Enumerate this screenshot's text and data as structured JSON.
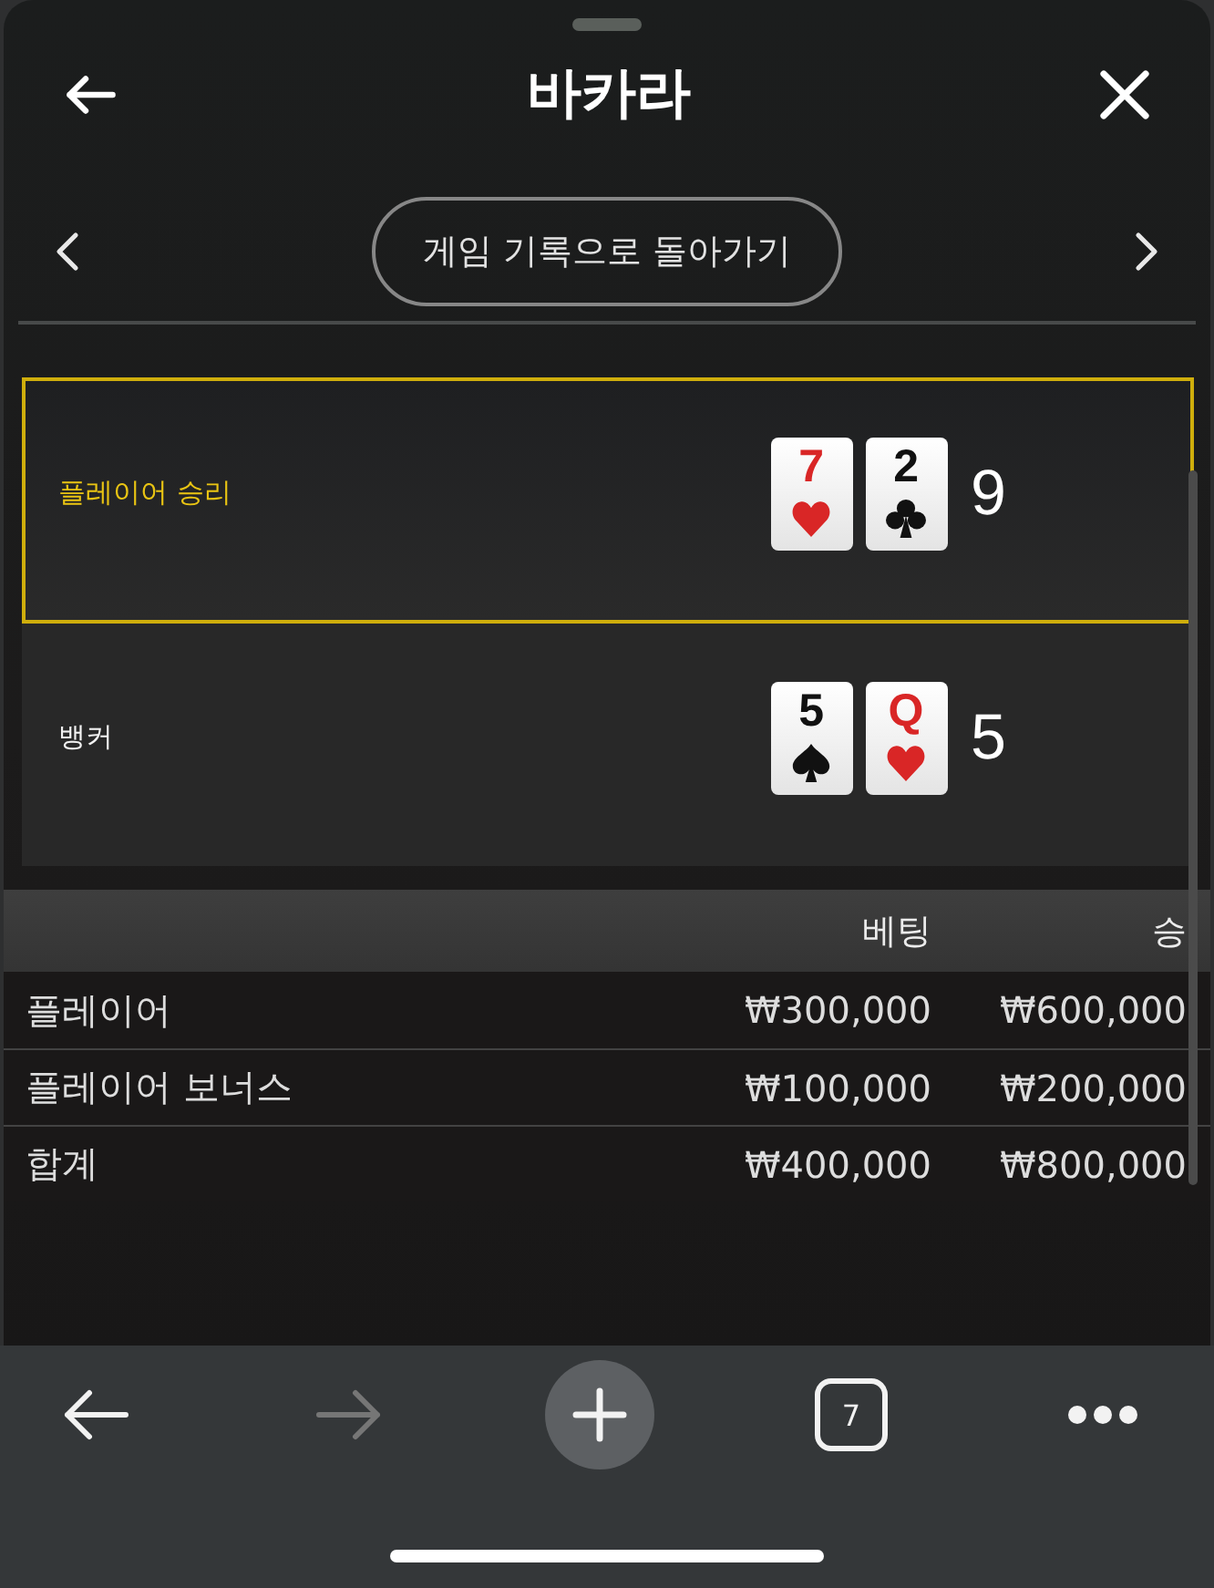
{
  "sheet": {
    "title": "바카라",
    "back_to_history": "게임 기록으로 돌아가기"
  },
  "hands": [
    {
      "label": "플레이어 승리",
      "winner": true,
      "cards": [
        {
          "rank": "7",
          "kind": "hearts"
        },
        {
          "rank": "2",
          "kind": "clubs"
        }
      ],
      "score": "9"
    },
    {
      "label": "뱅커",
      "winner": false,
      "cards": [
        {
          "rank": "5",
          "kind": "spades"
        },
        {
          "rank": "Q",
          "kind": "hearts"
        }
      ],
      "score": "5"
    }
  ],
  "bets_table": {
    "columns": [
      "베팅",
      "승"
    ],
    "rows": [
      {
        "name": "플레이어",
        "bet": "₩300,000",
        "win": "₩600,000"
      },
      {
        "name": "플레이어 보너스",
        "bet": "₩100,000",
        "win": "₩200,000"
      },
      {
        "name": "합계",
        "bet": "₩400,000",
        "win": "₩800,000"
      }
    ]
  },
  "browser_toolbar": {
    "buttons": [
      {
        "kind": "back",
        "disabled": false
      },
      {
        "kind": "forward",
        "disabled": true
      },
      {
        "kind": "new-tab",
        "disabled": false
      },
      {
        "kind": "tabs",
        "count": "7",
        "disabled": false
      },
      {
        "kind": "more",
        "disabled": false
      }
    ]
  }
}
